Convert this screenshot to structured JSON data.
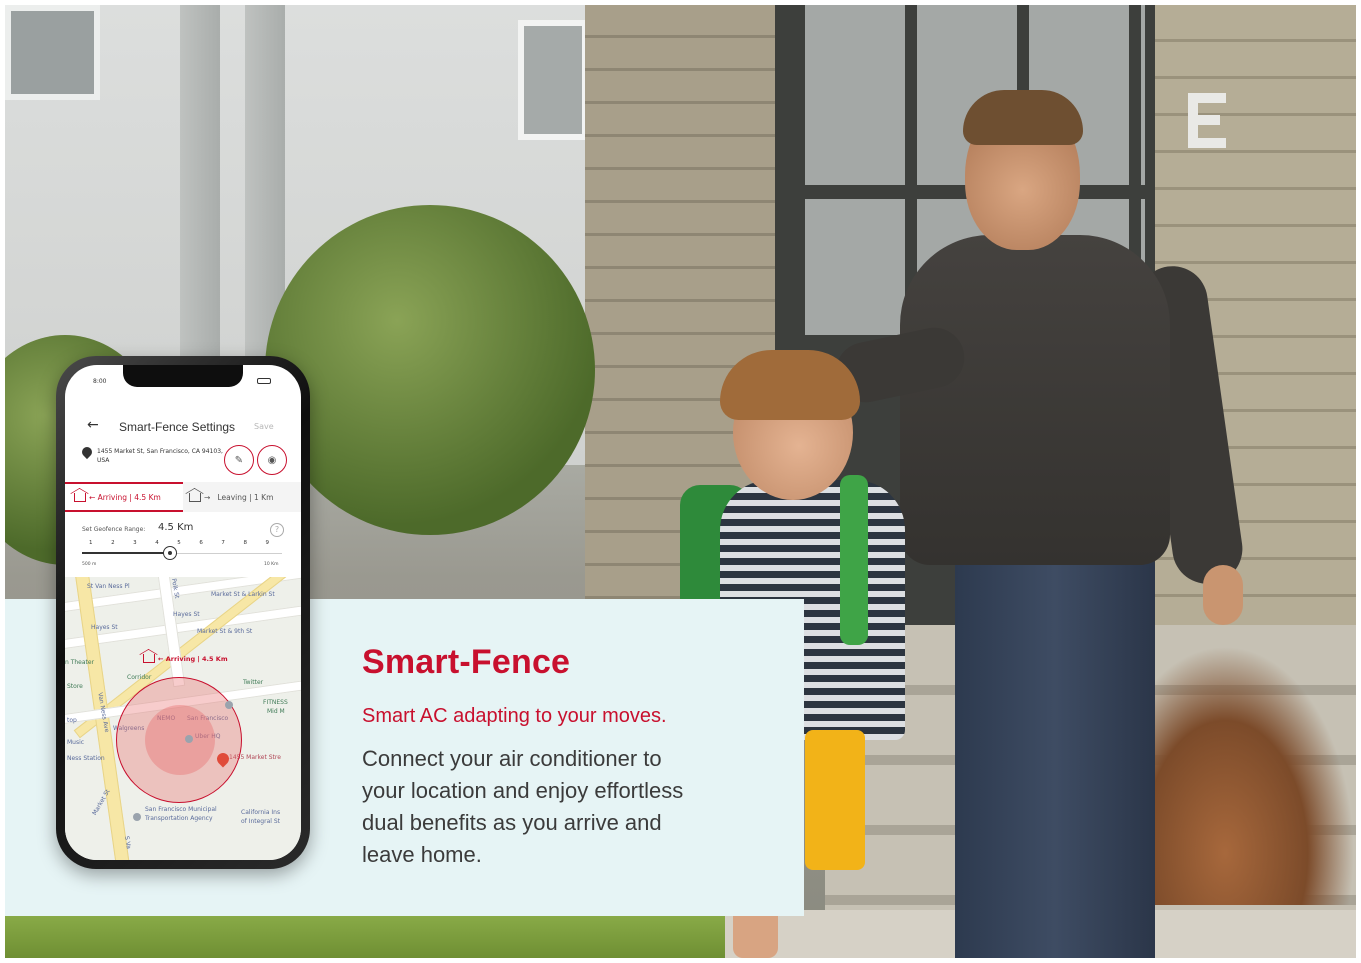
{
  "card": {
    "title": "Smart-Fence",
    "subtitle": "Smart AC adapting to your moves.",
    "body": "Connect your air conditioner to your location and enjoy effortless dual benefits as you arrive and leave home."
  },
  "phone": {
    "status_time": "8:00",
    "nav": {
      "back_icon": "back-arrow-icon",
      "title": "Smart-Fence Settings",
      "save_label": "Save"
    },
    "address": "1455 Market St, San Francisco, CA 94103, USA",
    "tabs": [
      {
        "label": "Arriving | 4.5 Km",
        "icon": "home-arrive-icon",
        "active": true
      },
      {
        "label": "Leaving | 1 Km",
        "icon": "home-leave-icon",
        "active": false
      }
    ],
    "geofence": {
      "label": "Set Geofence Range:",
      "value": "4.5 Km",
      "ticks": [
        "1",
        "2",
        "3",
        "4",
        "5",
        "6",
        "7",
        "8",
        "9"
      ],
      "slider_value_km": 4.5,
      "min_label": "500 m",
      "max_label": "10 Km"
    },
    "map": {
      "badge": "Arriving | 4.5 Km",
      "labels": [
        "St Van Ness Pl",
        "Polk St",
        "Market St & Larkin St",
        "Hayes St",
        "Hayes St",
        "Market St & 9th St",
        "n Theater",
        "Corridor",
        "Store",
        "Twitter",
        "FITNESS",
        "Mid M",
        "NEMO",
        "San Francisco",
        "top",
        "Walgreens",
        "Uber HQ",
        "Music",
        "Ness Station",
        "1455 Market Stre",
        "Van Ness Ave",
        "San Francisco Municipal",
        "Transportation Agency",
        "California Ins",
        "of Integral St",
        "Market St",
        "S Va"
      ]
    }
  },
  "colors": {
    "accent": "#c8102e",
    "card_bg": "#e6f4f5"
  }
}
